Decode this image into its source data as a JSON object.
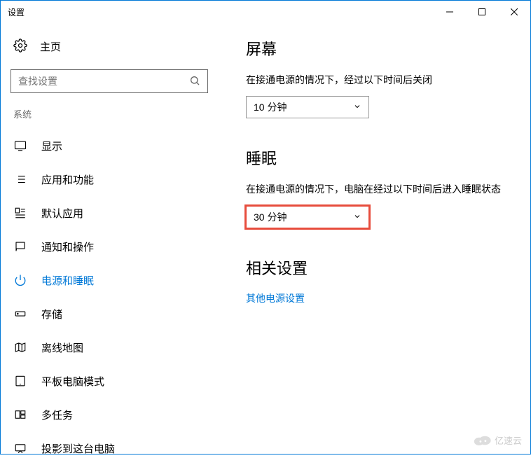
{
  "window": {
    "title": "设置"
  },
  "sidebar": {
    "home_label": "主页",
    "search_placeholder": "查找设置",
    "category_label": "系统",
    "items": [
      {
        "label": "显示"
      },
      {
        "label": "应用和功能"
      },
      {
        "label": "默认应用"
      },
      {
        "label": "通知和操作"
      },
      {
        "label": "电源和睡眠"
      },
      {
        "label": "存储"
      },
      {
        "label": "离线地图"
      },
      {
        "label": "平板电脑模式"
      },
      {
        "label": "多任务"
      },
      {
        "label": "投影到这台电脑"
      }
    ]
  },
  "main": {
    "screen": {
      "title": "屏幕",
      "label": "在接通电源的情况下，经过以下时间后关闭",
      "value": "10 分钟"
    },
    "sleep": {
      "title": "睡眠",
      "label": "在接通电源的情况下，电脑在经过以下时间后进入睡眠状态",
      "value": "30 分钟"
    },
    "related": {
      "title": "相关设置",
      "link": "其他电源设置"
    }
  },
  "watermark": "亿速云"
}
